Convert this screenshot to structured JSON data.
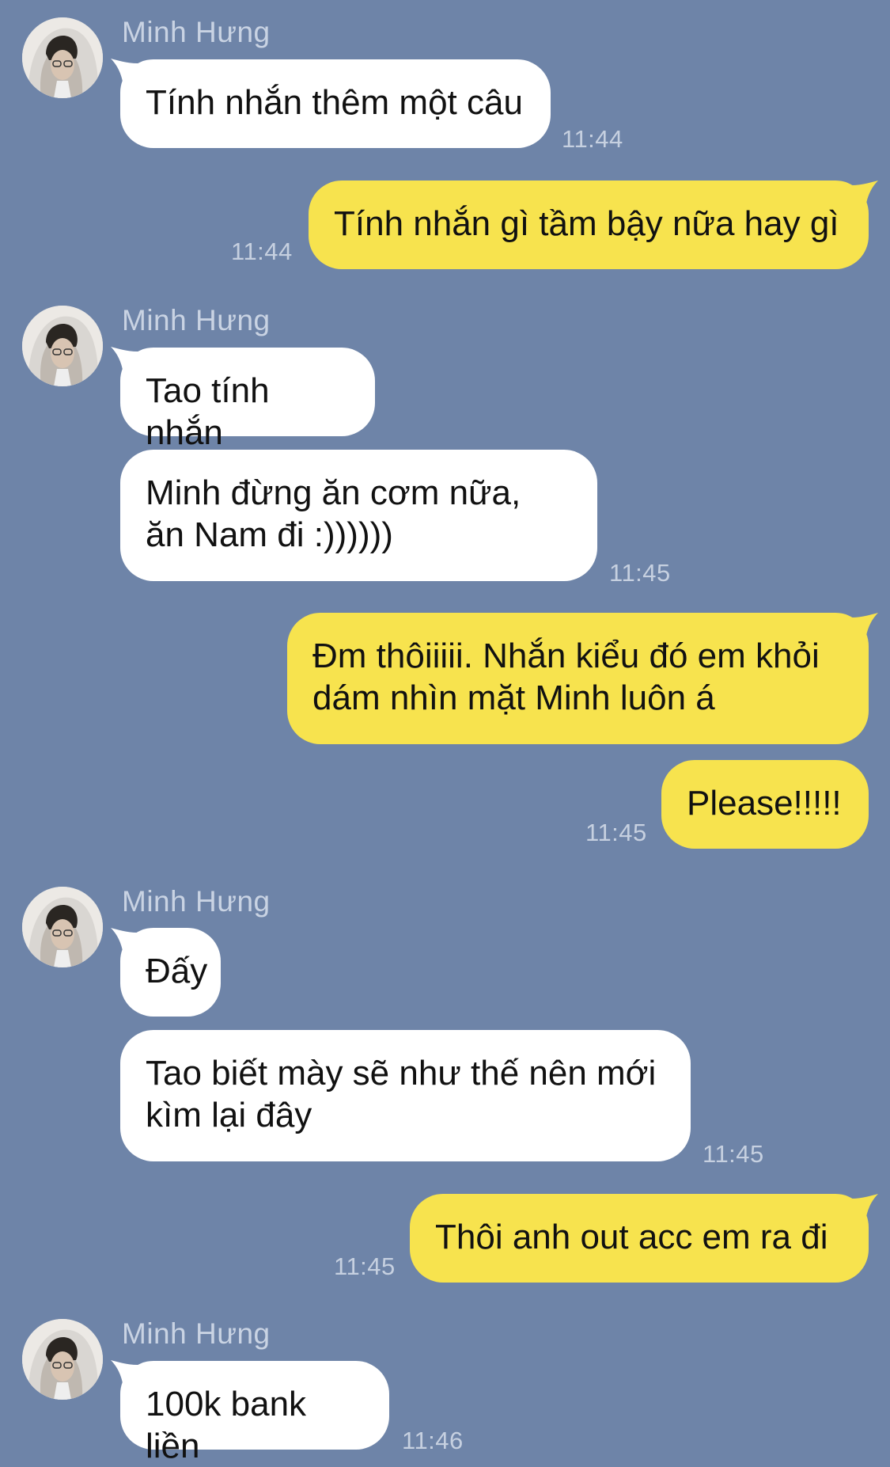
{
  "contact": {
    "name": "Minh Hưng"
  },
  "messages": [
    {
      "id": "m1",
      "from": "contact",
      "text": "Tính nhắn thêm một câu",
      "time": "11:44"
    },
    {
      "id": "m2",
      "from": "me",
      "text": "Tính nhắn gì tầm bậy nữa hay gì",
      "time": "11:44"
    },
    {
      "id": "m3",
      "from": "contact",
      "text": "Tao tính nhắn",
      "time": ""
    },
    {
      "id": "m4",
      "from": "contact",
      "text": "Minh đừng ăn cơm nữa, ăn Nam đi :))))))",
      "time": "11:45"
    },
    {
      "id": "m5",
      "from": "me",
      "text": "Đm thôiiiii. Nhắn kiểu đó em khỏi dám nhìn mặt Minh luôn á",
      "time": ""
    },
    {
      "id": "m6",
      "from": "me",
      "text": "Please!!!!!",
      "time": "11:45"
    },
    {
      "id": "m7",
      "from": "contact",
      "text": "Đấy",
      "time": ""
    },
    {
      "id": "m8",
      "from": "contact",
      "text": "Tao biết mày sẽ như thế nên mới kìm lại đây",
      "time": "11:45"
    },
    {
      "id": "m9",
      "from": "me",
      "text": "Thôi anh out acc em ra đi",
      "time": "11:45"
    },
    {
      "id": "m10",
      "from": "contact",
      "text": "100k bank liền",
      "time": "11:46"
    }
  ],
  "colors": {
    "background": "#6e84a8",
    "incoming_bubble": "#ffffff",
    "outgoing_bubble": "#f7e34e",
    "meta_text": "#c6d0e0"
  },
  "icons": {
    "avatar": "contact-avatar-photo"
  }
}
